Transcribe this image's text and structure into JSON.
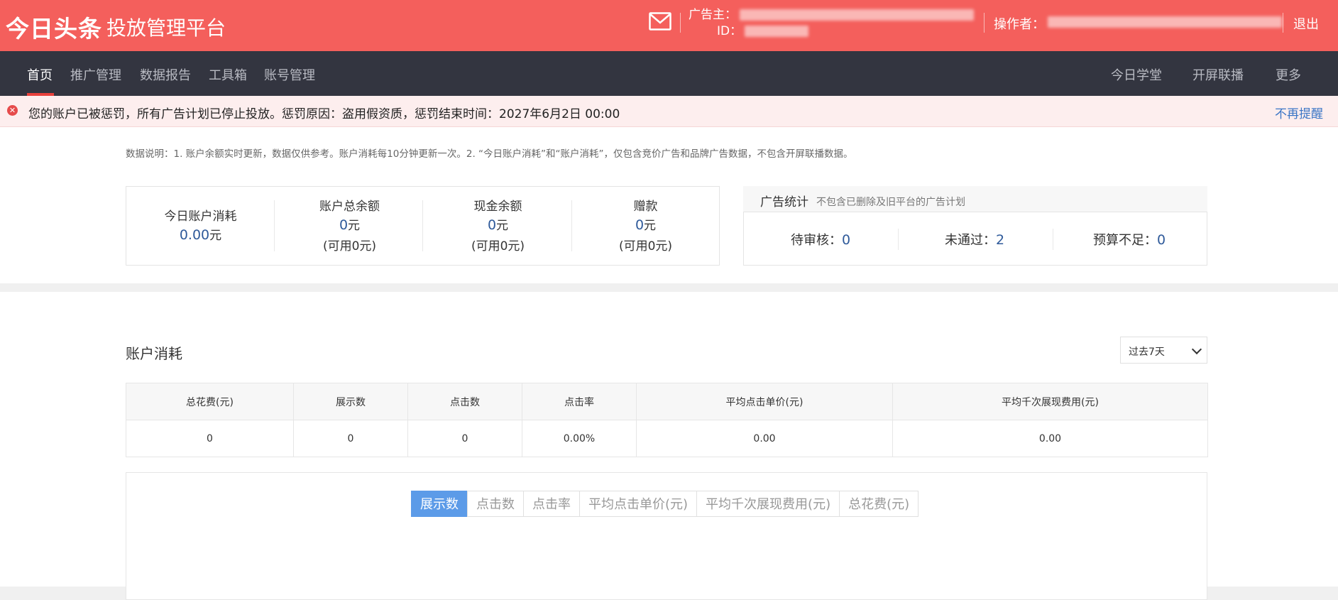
{
  "header": {
    "logo": "今日头条",
    "platform": "投放管理平台",
    "advertiser_label": "广告主：",
    "id_label": "ID：",
    "operator_label": "操作者：",
    "logout": "退出"
  },
  "nav": {
    "left": [
      "首页",
      "推广管理",
      "数据报告",
      "工具箱",
      "账号管理"
    ],
    "right": [
      "今日学堂",
      "开屏联播",
      "更多"
    ],
    "active_index": 0
  },
  "alert": {
    "message": "您的账户已被惩罚，所有广告计划已停止投放。惩罚原因：盗用假资质，惩罚结束时间：2027年6月2日 00:00",
    "dismiss": "不再提醒"
  },
  "notice": "数据说明：1. 账户余额实时更新，数据仅供参考。账户消耗每10分钟更新一次。2. “今日账户消耗”和“账户消耗”，仅包含竞价广告和品牌广告数据，不包含开屏联播数据。",
  "balance": {
    "today": {
      "label": "今日账户消耗",
      "value": "0.00",
      "unit": "元"
    },
    "total": {
      "label": "账户总余额",
      "value": "0",
      "unit": "元",
      "sub": "(可用0元)"
    },
    "cash": {
      "label": "现金余额",
      "value": "0",
      "unit": "元",
      "sub": "(可用0元)"
    },
    "gift": {
      "label": "赠款",
      "value": "0",
      "unit": "元",
      "sub": "(可用0元)"
    }
  },
  "ad_stats": {
    "title": "广告统计",
    "note": "不包含已删除及旧平台的广告计划",
    "pending_label": "待审核：",
    "pending": "0",
    "rejected_label": "未通过：",
    "rejected": "2",
    "budget_label": "预算不足：",
    "budget": "0"
  },
  "consumption": {
    "title": "账户消耗",
    "range": "过去7天",
    "headers": [
      "总花费(元)",
      "展示数",
      "点击数",
      "点击率",
      "平均点击单价(元)",
      "平均千次展现费用(元)"
    ],
    "row": [
      "0",
      "0",
      "0",
      "0.00%",
      "0.00",
      "0.00"
    ]
  },
  "chart_tabs": [
    "展示数",
    "点击数",
    "点击率",
    "平均点击单价(元)",
    "平均千次展现费用(元)",
    "总花费(元)"
  ],
  "colors": {
    "header": "#f45f5c",
    "nav": "#333540",
    "accent": "#5c9be8",
    "value": "#2f5a9a"
  }
}
